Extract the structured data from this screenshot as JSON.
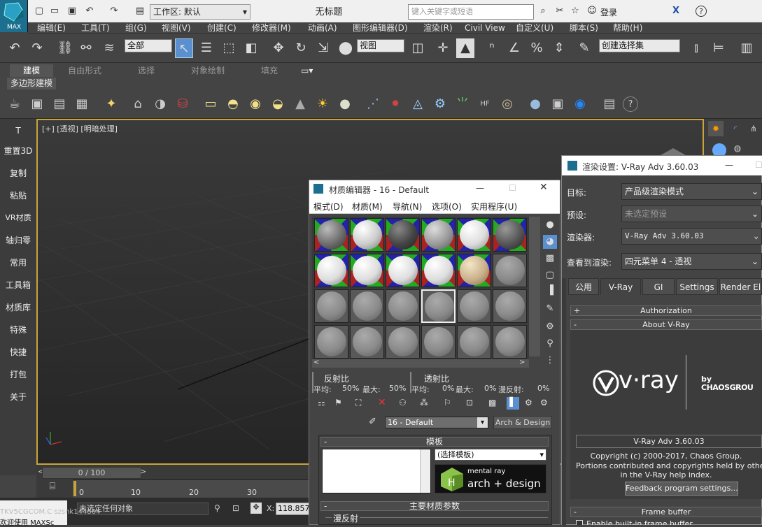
{
  "app": {
    "logo_text": "MAX",
    "doc_title": "无标题",
    "workspace_label": "工作区: 默认",
    "search_placeholder": "键入关键字或短语",
    "login": "登录"
  },
  "menubar": [
    "编辑(E)",
    "工具(T)",
    "组(G)",
    "视图(V)",
    "创建(C)",
    "修改器(M)",
    "动画(A)",
    "图形编辑器(D)",
    "渲染(R)",
    "Civil View",
    "自定义(U)",
    "脚本(S)",
    "帮助(H)"
  ],
  "toolbar": {
    "filter": "全部",
    "ref_coord": "视图",
    "selection_set": "创建选择集"
  },
  "ribbon": {
    "tabs": [
      "建模",
      "自由形式",
      "选择",
      "对象绘制",
      "填充"
    ],
    "sub_tab": "多边形建模"
  },
  "left_panel": [
    "T",
    "重置3D",
    "复制",
    "粘贴",
    "VR材质",
    "轴归零",
    "常用",
    "工具箱",
    "材质库",
    "特殊",
    "快捷",
    "打包",
    "关于"
  ],
  "viewport": {
    "label": "[+] [透视] [明暗处理]"
  },
  "timeline": {
    "frame": "0 / 100",
    "ticks": [
      "0",
      "10",
      "20",
      "30"
    ]
  },
  "status": {
    "selection": "未选定任何对象",
    "x_label": "X:",
    "x_value": "118.857",
    "watermark_line1": "TKV5CGCOM.C szsnk144864",
    "watermark_line2": "欢迎使用 MAXSc"
  },
  "material_editor": {
    "title": "材质编辑器 - 16 - Default",
    "menu": [
      "模式(D)",
      "材质(M)",
      "导航(N)",
      "选项(O)",
      "实用程序(U)"
    ],
    "reflect_label": "反射比",
    "reflect_avg": "平均:",
    "reflect_avg_val": "50%",
    "reflect_max": "最大:",
    "reflect_max_val": "50%",
    "transmit_label": "透射比",
    "trans_avg": "平均:",
    "trans_avg_val": "0%",
    "trans_max": "最大:",
    "trans_max_val": "0%",
    "diffuse_label": "漫反射:",
    "diffuse_val": "0%",
    "material_name": "16 - Default",
    "arch_button": "Arch & Design",
    "template_header": "模板",
    "template_select": "(选择模板)",
    "mr_line1": "mental ray",
    "mr_line2": "arch + design",
    "main_params_header": "主要材质参数",
    "diffuse_group": "漫反射"
  },
  "render_settings": {
    "title": "渲染设置: V-Ray Adv 3.60.03",
    "target_label": "目标:",
    "target_value": "产品级渲染模式",
    "preset_label": "预设:",
    "preset_value": "未选定预设",
    "renderer_label": "渲染器:",
    "renderer_value": "V-Ray Adv 3.60.03",
    "view_label": "查看到渲染:",
    "view_value": "四元菜单 4 - 透视",
    "tabs": [
      "公用",
      "V-Ray",
      "GI",
      "Settings",
      "Render El"
    ],
    "sec_authorization": "Authorization",
    "sec_about": "About V-Ray",
    "vray_logo": "v·ray",
    "by": "by",
    "chaos": "CHAOSGROU",
    "version": "V-Ray Adv 3.60.03",
    "copyright1": "Copyright (c) 2000-2017, Chaos Group.",
    "copyright2": "Portions contributed and copyrights held by others as in",
    "copyright3": "in the V-Ray help index.",
    "feedback": "Feedback program settings...",
    "sec_framebuffer": "Frame buffer",
    "enable_vfb": "Enable built-in frame buffer"
  },
  "colors": {
    "accent": "#c8a43a",
    "vray_blue": "#2c6cb0",
    "select_green": "#4a4"
  }
}
